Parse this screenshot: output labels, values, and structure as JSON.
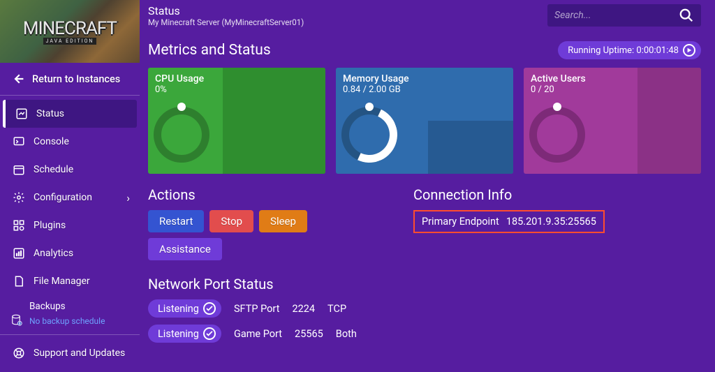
{
  "header": {
    "title": "Status",
    "subtitle": "My Minecraft Server (MyMinecraftServer01)",
    "search_placeholder": "Search..."
  },
  "logo_text": "MINECRAFT",
  "logo_subtext": "JAVA EDITION",
  "return_link_label": "Return to Instances",
  "sidebar": {
    "items": [
      {
        "label": "Status",
        "selected": true
      },
      {
        "label": "Console"
      },
      {
        "label": "Schedule"
      },
      {
        "label": "Configuration",
        "chevron": true
      },
      {
        "label": "Plugins"
      },
      {
        "label": "Analytics"
      },
      {
        "label": "File Manager"
      }
    ],
    "backups_label": "Backups",
    "backups_note": "No backup schedule",
    "support_label": "Support and Updates"
  },
  "metrics": {
    "section_title": "Metrics and Status",
    "uptime_pill_text": "Running Uptime: 0:00:01:48",
    "cpu": {
      "title": "CPU Usage",
      "value": "0%"
    },
    "mem": {
      "title": "Memory Usage",
      "value": "0.84 / 2.00 GB"
    },
    "users": {
      "title": "Active Users",
      "value": "0 / 20"
    }
  },
  "actions": {
    "section_title": "Actions",
    "restart": "Restart",
    "stop": "Stop",
    "sleep": "Sleep",
    "assist": "Assistance"
  },
  "connection": {
    "section_title": "Connection Info",
    "label": "Primary Endpoint",
    "value": "185.201.9.35:25565"
  },
  "ports": {
    "section_title": "Network Port Status",
    "listening": "Listening",
    "rows": [
      {
        "name": "SFTP Port",
        "port": "2224",
        "proto": "TCP"
      },
      {
        "name": "Game Port",
        "port": "25565",
        "proto": "Both"
      }
    ]
  }
}
